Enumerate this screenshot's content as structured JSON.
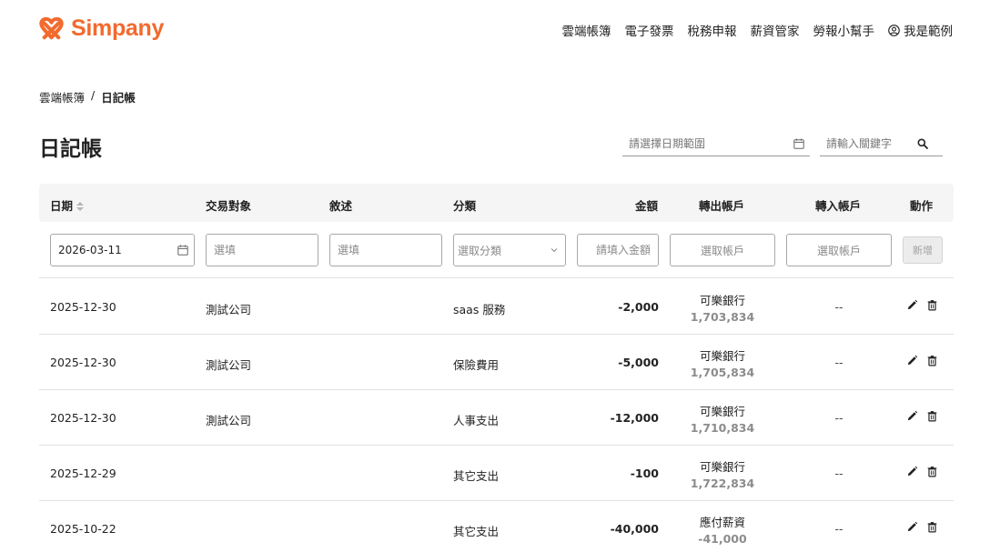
{
  "brand": {
    "name": "Simpany",
    "color": "#f26a2e",
    "icon": "simpany-logo-icon"
  },
  "nav": {
    "items": [
      "雲端帳簿",
      "電子發票",
      "稅務申報",
      "薪資管家",
      "勞報小幫手"
    ],
    "user_label": "我是範例",
    "user_icon": "user-circle-icon"
  },
  "breadcrumb": {
    "parent": "雲端帳簿",
    "separator": "/",
    "current": "日記帳"
  },
  "page_title": "日記帳",
  "filters": {
    "date_range_placeholder": "請選擇日期範圍",
    "keyword_placeholder": "請輸入關鍵字"
  },
  "table": {
    "headers": {
      "date": "日期",
      "party": "交易對象",
      "desc": "敘述",
      "category": "分類",
      "amount": "金額",
      "from": "轉出帳戶",
      "to": "轉入帳戶",
      "action": "動作"
    },
    "entry": {
      "date_value": "2026-03-11",
      "party_placeholder": "選填",
      "desc_placeholder": "選填",
      "category_placeholder": "選取分類",
      "amount_placeholder": "請填入金額",
      "from_placeholder": "選取帳戶",
      "to_placeholder": "選取帳戶",
      "add_label": "新增"
    },
    "rows": [
      {
        "date": "2025-12-30",
        "party": "測試公司",
        "desc": "",
        "category": "saas 服務",
        "amount": "-2,000",
        "from_name": "可樂銀行",
        "from_balance": "1,703,834",
        "to": "--"
      },
      {
        "date": "2025-12-30",
        "party": "測試公司",
        "desc": "",
        "category": "保險費用",
        "amount": "-5,000",
        "from_name": "可樂銀行",
        "from_balance": "1,705,834",
        "to": "--"
      },
      {
        "date": "2025-12-30",
        "party": "測試公司",
        "desc": "",
        "category": "人事支出",
        "amount": "-12,000",
        "from_name": "可樂銀行",
        "from_balance": "1,710,834",
        "to": "--"
      },
      {
        "date": "2025-12-29",
        "party": "",
        "desc": "",
        "category": "其它支出",
        "amount": "-100",
        "from_name": "可樂銀行",
        "from_balance": "1,722,834",
        "to": "--"
      },
      {
        "date": "2025-10-22",
        "party": "",
        "desc": "",
        "category": "其它支出",
        "amount": "-40,000",
        "from_name": "應付薪資",
        "from_balance": "-41,000",
        "to": "--"
      }
    ]
  }
}
